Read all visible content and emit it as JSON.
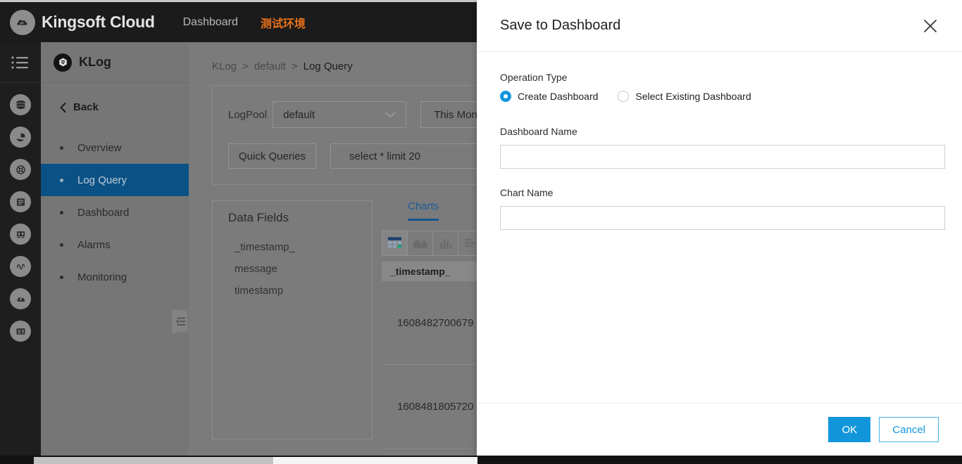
{
  "topbar": {
    "brand_name": "Kingsoft Cloud",
    "logo_icon": "cloud-logo-icon",
    "nav_items": [
      {
        "label": "Dashboard",
        "accent": false
      },
      {
        "label": "测试环境",
        "accent": true
      }
    ]
  },
  "rail": {
    "menu_icon": "hamburger-menu-icon",
    "icons": [
      "database-icon",
      "pie-chart-icon",
      "lifebuoy-icon",
      "server-icon",
      "presentation-icon",
      "waveform-icon",
      "cloud-upload-icon",
      "id-card-icon"
    ]
  },
  "klog": {
    "badge_icon": "klog-logo-icon",
    "title": "KLog",
    "back_label": "Back",
    "back_icon": "chevron-left-icon",
    "collapse_icon": "collapse-panel-icon",
    "nav": [
      {
        "label": "Overview",
        "active": false
      },
      {
        "label": "Log Query",
        "active": true
      },
      {
        "label": "Dashboard",
        "active": false
      },
      {
        "label": "Alarms",
        "active": false
      },
      {
        "label": "Monitoring",
        "active": false
      }
    ]
  },
  "main": {
    "breadcrumb": [
      "KLog",
      "default",
      "Log Query"
    ],
    "breadcrumb_sep": ">",
    "logpool_label": "LogPool",
    "logpool_value": "default",
    "logpool_caret_icon": "chevron-down-icon",
    "time_range_label": "This Month",
    "quick_queries_label": "Quick Queries",
    "query_value": "select * limit 20",
    "fields_title": "Data Fields",
    "fields": [
      "_timestamp_",
      "message",
      "timestamp"
    ],
    "charts_tab_label": "Charts",
    "chart_tools": [
      "table-chart-icon",
      "area-chart-icon",
      "bar-chart-icon",
      "horizontal-bar-chart-icon"
    ],
    "table_header": "_timestamp_",
    "table_rows": [
      "1608482700679",
      "1608481805720"
    ]
  },
  "modal": {
    "title": "Save to Dashboard",
    "close_icon": "close-icon",
    "operation_type_label": "Operation Type",
    "radio_options": [
      {
        "label": "Create Dashboard",
        "selected": true
      },
      {
        "label": "Select Existing Dashboard",
        "selected": false
      }
    ],
    "dashboard_name_label": "Dashboard Name",
    "dashboard_name_value": "",
    "dashboard_name_placeholder": "",
    "chart_name_label": "Chart Name",
    "chart_name_value": "",
    "chart_name_placeholder": "",
    "ok_label": "OK",
    "cancel_label": "Cancel"
  },
  "colors": {
    "accent_orange": "#e8701a",
    "primary_blue": "#1296db",
    "active_nav_blue": "#0a5186",
    "topbar_dark": "#1b1b1b"
  },
  "scrollbar": {
    "name": "horizontal-scrollbar"
  }
}
